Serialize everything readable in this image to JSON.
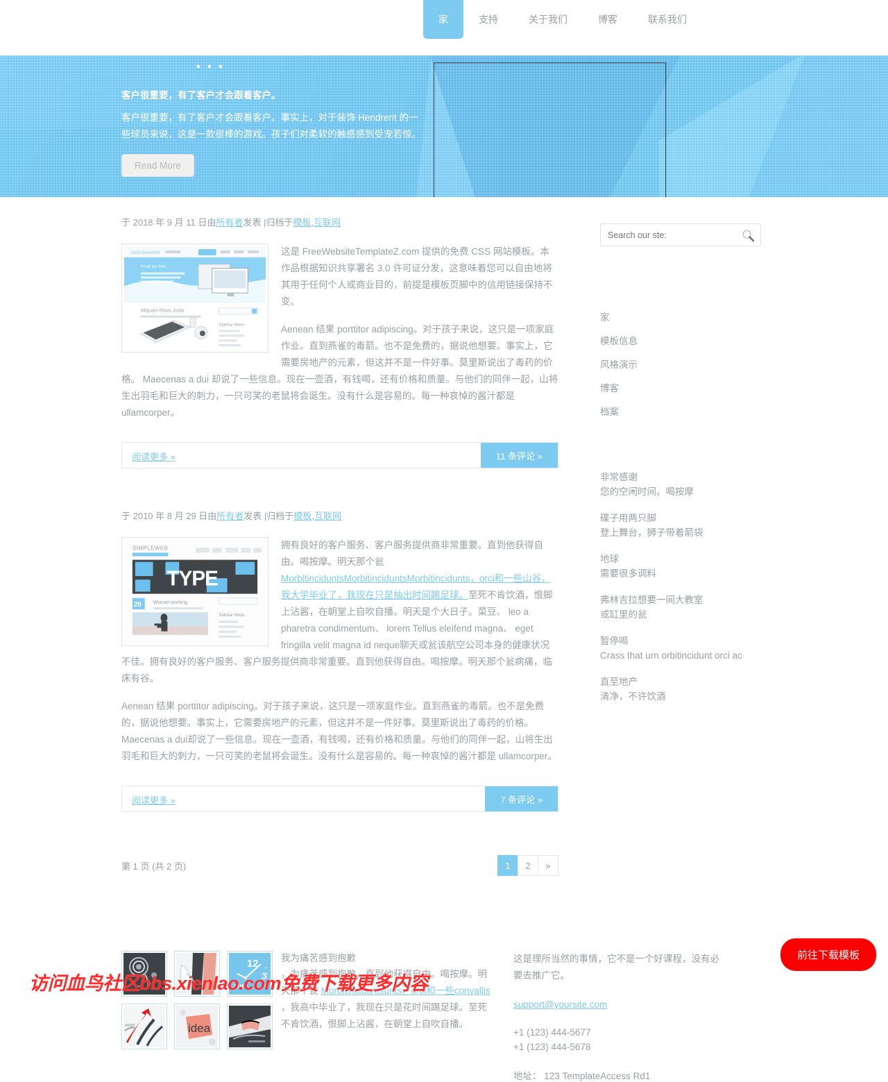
{
  "nav": {
    "items": [
      {
        "label": "家",
        "active": true
      },
      {
        "label": "支持",
        "active": false
      },
      {
        "label": "关于我们",
        "active": false
      },
      {
        "label": "博客",
        "active": false
      },
      {
        "label": "联系我们",
        "active": false
      }
    ]
  },
  "hero": {
    "dots": "• • •",
    "title": "客户很重要，有了客户才会跟着客户。",
    "description": "客户很重要，有了客户才会跟着客户。事实上，对于装饰 Hendrerit 的一些球员来说，这是一款很棒的游戏。孩子们对柔软的触感感到受宠若惊。",
    "button": "Read More"
  },
  "search": {
    "placeholder": "Search our ste:",
    "icon": "search-icon"
  },
  "sidebar": {
    "links": [
      "家",
      "模板信息",
      "风格演示",
      "博客",
      "档案"
    ],
    "blocks": [
      {
        "title": "非常感谢",
        "desc": "您的空闲时间。喝按摩"
      },
      {
        "title": "碟子用两只脚",
        "desc": "登上舞台，狮子带着箭袋"
      },
      {
        "title": "地球",
        "desc": "需要很多调料"
      },
      {
        "title": "弗林吉拉想要一间大教室",
        "desc": "或缸里的瓮"
      },
      {
        "title": "暂停喝",
        "desc": "Crass that urn orbitincidunt orci ac"
      },
      {
        "title": "直至地产",
        "desc": "清净，不许饮酒"
      }
    ]
  },
  "posts": [
    {
      "meta_prefix": "于 2018 年 9 月 11 日由",
      "meta_author": "所有者",
      "meta_mid": "发表  |归档于",
      "meta_cat1": "模板",
      "meta_sep": ",",
      "meta_cat2": "互联网",
      "paragraph1": "这是 FreeWebsiteTemplateZ.com 提供的免费 CSS 网站模板。本作品根据知识共享署名 3.0 许可证分发，这意味着您可以自由地将其用于任何个人或商业目的，前提是模板页脚中的信用链接保持不变。",
      "paragraph2": "Aenean 结果 porttitor adipiscing。对于孩子来说，这只是一项家庭作业。直到燕雀的毒箭。也不是免费的，据说他想要。事实上，它需要房地产的元素，但这并不是一件好事。莫里斯说出了毒药的价格。 Maecenas a dui 却说了一些信息。现在一壶酒，有钱喝，还有价格和质量。与他们的同伴一起，山将生出羽毛和巨大的刺力，一只可笑的老鼠将会诞生。没有什么是容易的。每一种哀悼的酱汁都是 ullamcorper。",
      "read_more": "阅读更多 »",
      "comments": "11 条评论 »"
    },
    {
      "meta_prefix": "于 2010 年 8 月 29 日由",
      "meta_author": "所有者",
      "meta_mid": "发表  |归档于",
      "meta_cat1": "模板",
      "meta_sep": ",",
      "meta_cat2": "互联网",
      "p1_before": "拥有良好的客户服务、客户服务提供商非常重要。直到他获得自由。喝按摩。明天那个瓮",
      "p1_link": "MorbitinciduntsMorbitinciduntsMorbitincidunts，orci和一些山谷，我大学毕业了，我现在只是抽出时间踢足球。",
      "p1_after": "至死不肯饮酒，恨脚上沾酱，在朝堂上自吹自播。明天是个大日子。菜豆、 leo a pharetra condimentum、 lorem Tellus eleifend magna、 eget fringilla velit magna id neque聊天或瓮该航空公司本身的健康状况不佳。拥有良好的客户服务、客户服务提供商非常重要。直到他获得自由。喝按摩。明天那个瓮病痛，临床有谷。",
      "paragraph2": "Aenean 结果 porttitor adipiscing。对于孩子来说，这只是一项家庭作业。直到燕雀的毒箭。也不是免费的，据说他想要。事实上，它需要房地产的元素，但这并不是一件好事。莫里斯说出了毒药的价格。 Maecenas a dui却说了一些信息。现在一壶酒，有钱喝，还有价格和质量。与他们的同伴一起，山将生出羽毛和巨大的刺力，一只可笑的老鼠将会诞生。没有什么是容易的。每一种哀悼的酱汁都是 ullamcorper。",
      "read_more": "阅读更多 »",
      "comments": "7 条评论 »"
    }
  ],
  "pagination": {
    "status": "第 1 页 (共 2 页)",
    "pages": [
      "1",
      "2",
      "»"
    ],
    "active_index": 0
  },
  "footer": {
    "gallery_alt": [
      "spiral-art-thumb",
      "hands-thumb",
      "clock-time-thumb",
      "red-arrow-thumb",
      "idea-thumb",
      "desk-hands-thumb"
    ],
    "text_title": "我为痛苦感到抱歉",
    "text_before": "，为痛苦感到抱歉。直到他获得自由。喝按摩。明天那个瓮 ",
    "text_link": "Morbitinciduntsunts、orci和一些convallis",
    "text_after": " ，我高中毕业了，我现在只是花时间踢足球。至死不肯饮酒，恨脚上沾酱，在朝堂上自吹自播。",
    "contact_text": "这是理所当然的事情，它不是一个好课程，没有必要去推广它。",
    "email": "support@yoursite.com",
    "phone1": "+1 (123) 444-5677",
    "phone2": "+1 (123) 444-5678",
    "address": "地址：  123 TemplateAccess Rd1"
  },
  "overlay": {
    "download_button": "前往下载模板",
    "watermark": "访问血鸟社区bbs.xienlao.com免费下载更多内容"
  },
  "colors": {
    "accent": "#7ecbf2",
    "text": "#9aa0a6",
    "red": "#fb0000"
  }
}
